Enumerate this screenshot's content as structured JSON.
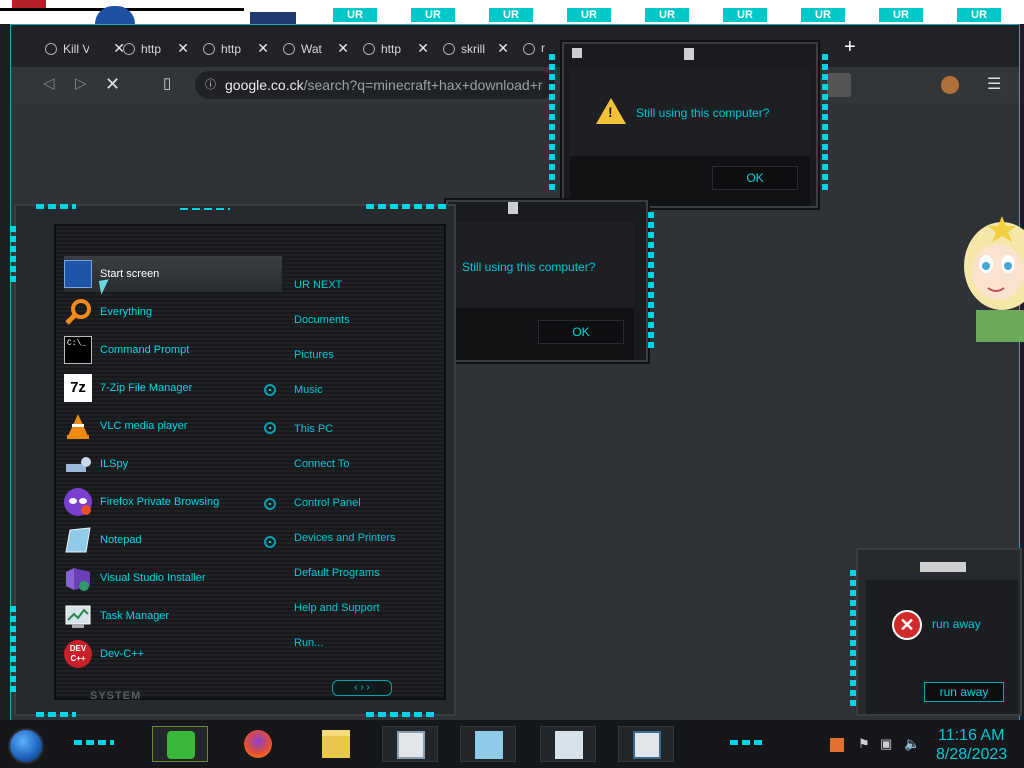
{
  "top_strip": {
    "ur_labels": [
      "UR",
      "UR",
      "UR",
      "UR",
      "UR",
      "UR",
      "UR",
      "UR",
      "UR"
    ]
  },
  "browser": {
    "tabs": [
      {
        "label": "Kill V",
        "icon": "tab-icon"
      },
      {
        "label": "http",
        "icon": "globe-icon"
      },
      {
        "label": "http",
        "icon": "globe-icon"
      },
      {
        "label": "Wat",
        "icon": "globe-icon"
      },
      {
        "label": "http",
        "icon": "globe-icon"
      },
      {
        "label": "skrill",
        "icon": "globe-icon"
      },
      {
        "label": "r",
        "icon": "globe-icon"
      }
    ],
    "new_tab_label": "+",
    "address": {
      "host": "google.co.ck",
      "path": "/search?q=minecraft+hax+download+r"
    }
  },
  "dialog_top": {
    "message": "Still using this computer?",
    "ok_label": "OK"
  },
  "dialog_mid": {
    "message": "Still using this computer?",
    "ok_label": "OK"
  },
  "start_menu": {
    "programs": [
      {
        "label": "Start screen",
        "icon": "start-screen-icon",
        "selected": true
      },
      {
        "label": "Everything",
        "icon": "magnifier-icon"
      },
      {
        "label": "Command Prompt",
        "icon": "terminal-icon"
      },
      {
        "label": "7-Zip File Manager",
        "icon": "7zip-icon",
        "has_submenu": true
      },
      {
        "label": "VLC media player",
        "icon": "vlc-icon",
        "has_submenu": true
      },
      {
        "label": "ILSpy",
        "icon": "ilspy-icon"
      },
      {
        "label": "Firefox Private Browsing",
        "icon": "private-browsing-icon",
        "has_submenu": true
      },
      {
        "label": "Notepad",
        "icon": "notepad-icon",
        "has_submenu": true
      },
      {
        "label": "Visual Studio Installer",
        "icon": "visual-studio-icon"
      },
      {
        "label": "Task Manager",
        "icon": "task-manager-icon"
      },
      {
        "label": "Dev-C++",
        "icon": "devcpp-icon"
      }
    ],
    "places": [
      "UR NEXT",
      "Documents",
      "Pictures",
      "Music",
      "This PC",
      "Connect To",
      "Control Panel",
      "Devices and Printers",
      "Default Programs",
      "Help and Support",
      "Run..."
    ],
    "footer_label": "SYSTEM"
  },
  "error_dialog": {
    "message": "run away",
    "button_label": "run away"
  },
  "taskbar": {
    "items": [
      "notes-app",
      "firefox",
      "file-explorer",
      "document-viewer",
      "notepad",
      "task-manager",
      "window-app"
    ],
    "time": "11:16 AM",
    "date": "8/28/2023"
  }
}
